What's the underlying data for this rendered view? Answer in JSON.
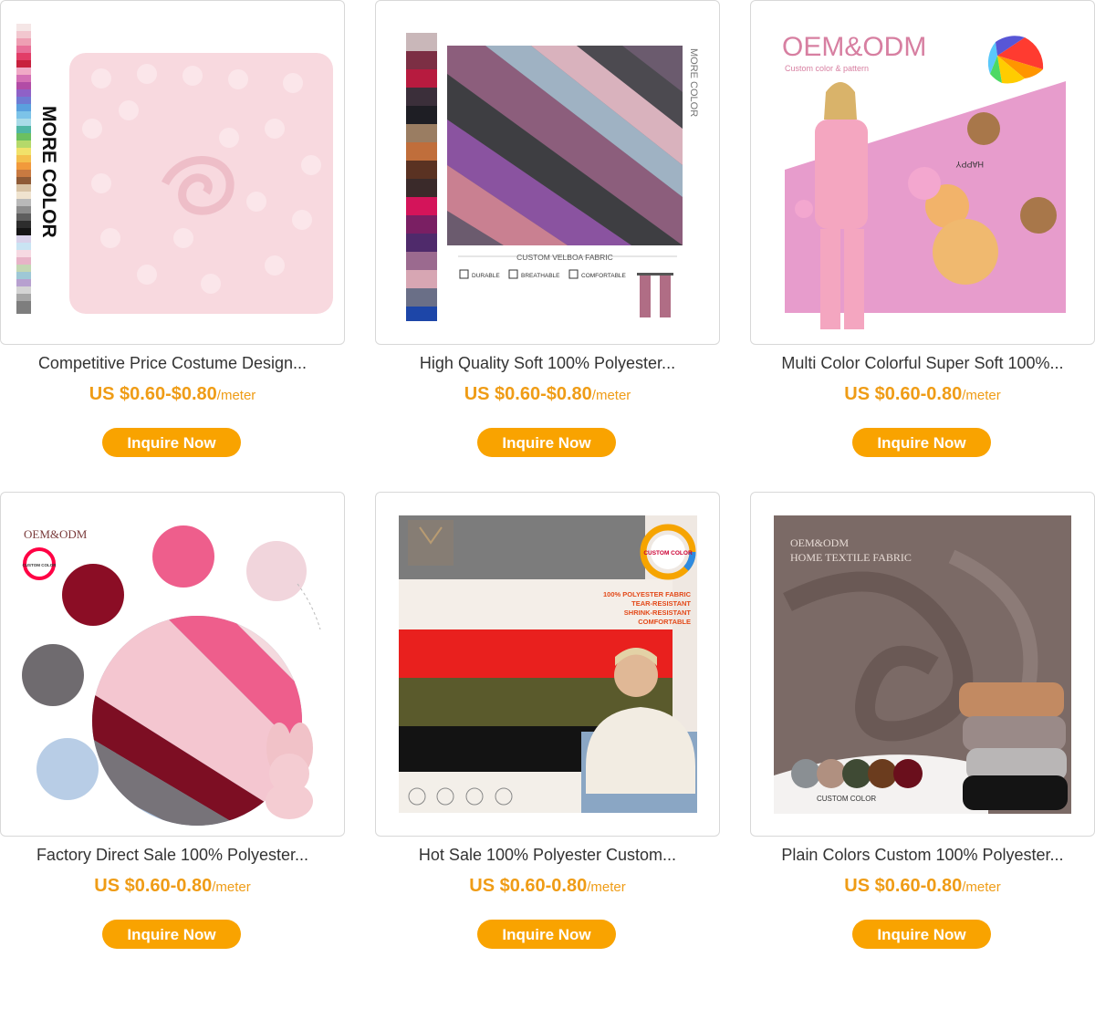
{
  "products": [
    {
      "title": "Competitive Price Costume Design...",
      "price": "US $0.60-$0.80",
      "unit": "/meter",
      "button": "Inquire Now",
      "image_text": {
        "vertical_label": "MORE COLOR"
      }
    },
    {
      "title": "High Quality Soft 100% Polyester...",
      "price": "US $0.60-$0.80",
      "unit": "/meter",
      "button": "Inquire Now",
      "image_text": {
        "vertical_label": "MORE COLOR",
        "caption": "CUSTOM VELBOA FABRIC",
        "features": [
          "DURABLE",
          "BREATHABLE",
          "COMFORTABLE"
        ]
      }
    },
    {
      "title": "Multi Color Colorful Super Soft 100%...",
      "price": "US $0.60-0.80",
      "unit": "/meter",
      "button": "Inquire Now",
      "image_text": {
        "heading": "OEM&ODM",
        "subheading": "Custom color & pattern",
        "pattern_text": "HAPPY"
      }
    },
    {
      "title": "Factory Direct Sale 100% Polyester...",
      "price": "US $0.60-0.80",
      "unit": "/meter",
      "button": "Inquire Now",
      "image_text": {
        "heading": "OEM&ODM",
        "badge": "CUSTOM COLOR"
      }
    },
    {
      "title": "Hot Sale 100% Polyester Custom...",
      "price": "US $0.60-0.80",
      "unit": "/meter",
      "button": "Inquire Now",
      "image_text": {
        "badge": "CUSTOM COLOR",
        "features": [
          "100% POLYESTER FABRIC",
          "TEAR-RESISTANT",
          "SHRINK-RESISTANT",
          "COMFORTABLE"
        ]
      }
    },
    {
      "title": "Plain Colors Custom 100% Polyester...",
      "price": "US $0.60-0.80",
      "unit": "/meter",
      "button": "Inquire Now",
      "image_text": {
        "heading": "OEM&ODM",
        "subheading": "HOME TEXTILE FABRIC",
        "caption": "CUSTOM COLOR"
      }
    }
  ],
  "colors": {
    "accent": "#f9a300",
    "price": "#ef9c16",
    "card_border": "#d8d8d8",
    "text": "#333333"
  }
}
